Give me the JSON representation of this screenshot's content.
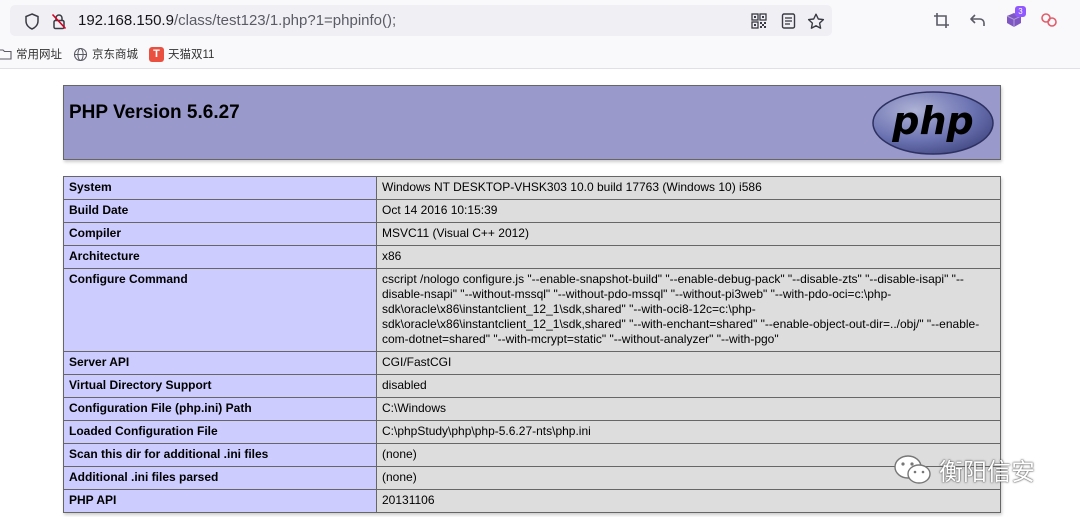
{
  "browser": {
    "url_host": "192.168.150.9",
    "url_path": "/class/test123/1.php?1=phpinfo();",
    "extension_badge": "3",
    "bookmarks": [
      {
        "label": "常用网址",
        "icon": "folder-icon"
      },
      {
        "label": "京东商城",
        "icon": "globe-icon"
      },
      {
        "label": "天猫双11",
        "icon": "tmall-icon",
        "icon_letter": "T"
      }
    ]
  },
  "header": {
    "title": "PHP Version 5.6.27",
    "logo_text": "php"
  },
  "info_table": [
    {
      "key": "System",
      "value": "Windows NT DESKTOP-VHSK303 10.0 build 17763 (Windows 10) i586"
    },
    {
      "key": "Build Date",
      "value": "Oct 14 2016 10:15:39"
    },
    {
      "key": "Compiler",
      "value": "MSVC11 (Visual C++ 2012)"
    },
    {
      "key": "Architecture",
      "value": "x86"
    },
    {
      "key": "Configure Command",
      "value": "cscript /nologo configure.js \"--enable-snapshot-build\" \"--enable-debug-pack\" \"--disable-zts\" \"--disable-isapi\" \"--disable-nsapi\" \"--without-mssql\" \"--without-pdo-mssql\" \"--without-pi3web\" \"--with-pdo-oci=c:\\php-sdk\\oracle\\x86\\instantclient_12_1\\sdk,shared\" \"--with-oci8-12c=c:\\php-sdk\\oracle\\x86\\instantclient_12_1\\sdk,shared\" \"--with-enchant=shared\" \"--enable-object-out-dir=../obj/\" \"--enable-com-dotnet=shared\" \"--with-mcrypt=static\" \"--without-analyzer\" \"--with-pgo\""
    },
    {
      "key": "Server API",
      "value": "CGI/FastCGI"
    },
    {
      "key": "Virtual Directory Support",
      "value": "disabled"
    },
    {
      "key": "Configuration File (php.ini) Path",
      "value": "C:\\Windows"
    },
    {
      "key": "Loaded Configuration File",
      "value": "C:\\phpStudy\\php\\php-5.6.27-nts\\php.ini"
    },
    {
      "key": "Scan this dir for additional .ini files",
      "value": "(none)"
    },
    {
      "key": "Additional .ini files parsed",
      "value": "(none)"
    },
    {
      "key": "PHP API",
      "value": "20131106"
    }
  ],
  "watermark": {
    "text": "衡阳信安",
    "icon": "wechat-icon"
  },
  "colors": {
    "header_bg": "#9999cc",
    "key_bg": "#ccccff",
    "value_bg": "#dddddd",
    "badge": "#9059ff"
  }
}
